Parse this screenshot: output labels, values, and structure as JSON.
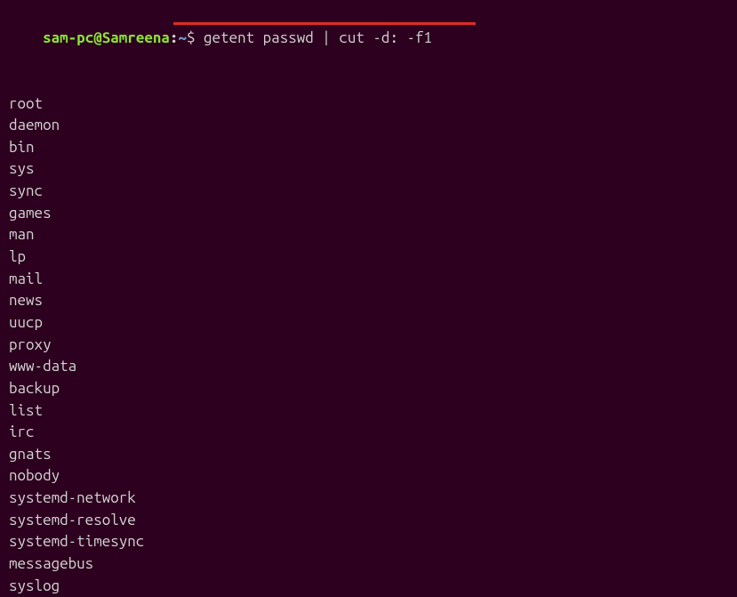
{
  "prompt": {
    "user_host": "sam-pc@Samreena",
    "separator": ":",
    "path": "~",
    "symbol": "$ "
  },
  "command": "getent passwd | cut -d: -f1",
  "output": [
    "root",
    "daemon",
    "bin",
    "sys",
    "sync",
    "games",
    "man",
    "lp",
    "mail",
    "news",
    "uucp",
    "proxy",
    "www-data",
    "backup",
    "list",
    "irc",
    "gnats",
    "nobody",
    "systemd-network",
    "systemd-resolve",
    "systemd-timesync",
    "messagebus",
    "syslog"
  ]
}
